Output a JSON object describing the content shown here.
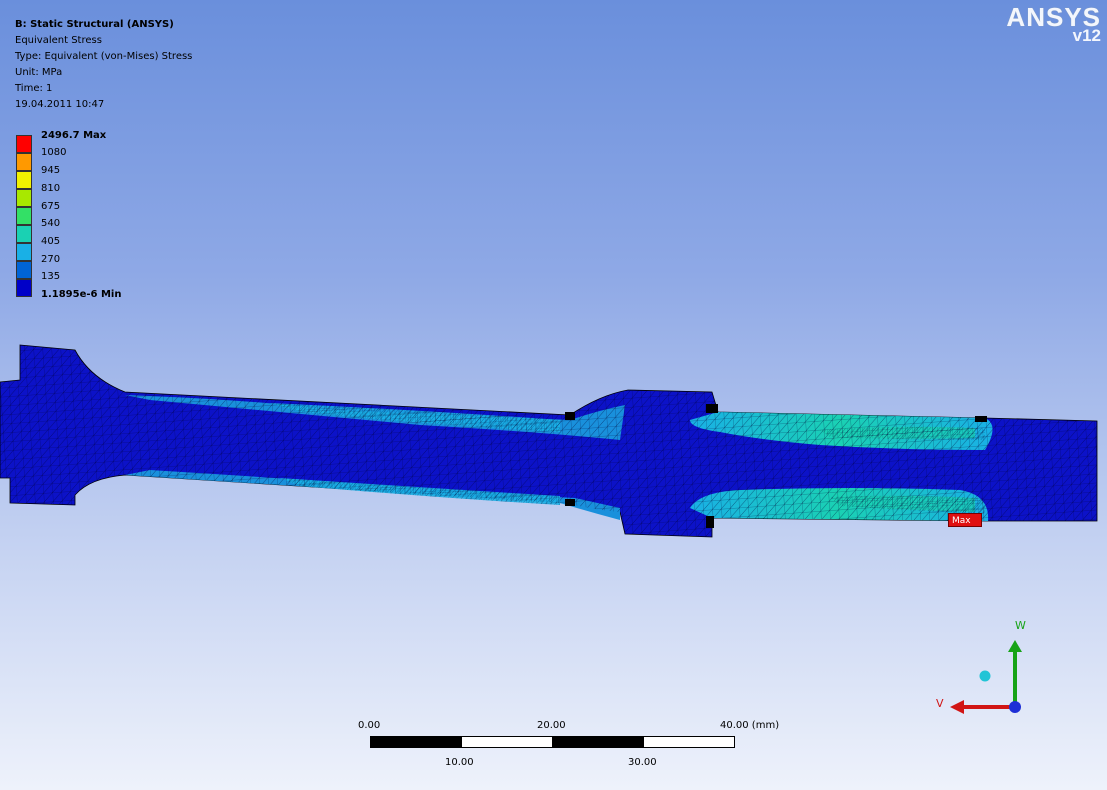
{
  "header": {
    "title": "B: Static Structural (ANSYS)",
    "result": "Equivalent Stress",
    "type": "Type: Equivalent (von-Mises) Stress",
    "unit": "Unit: MPa",
    "time": "Time: 1",
    "date": "19.04.2011 10:47"
  },
  "logo": {
    "name": "ANSYS",
    "version": "v12"
  },
  "legend": {
    "max_label": "2496.7 Max",
    "min_label": "1.1895e-6 Min",
    "levels": [
      "1080",
      "945",
      "810",
      "675",
      "540",
      "405",
      "270",
      "135"
    ],
    "colors": [
      "#ff0000",
      "#ff9900",
      "#f2f200",
      "#a8e800",
      "#33e066",
      "#1ad1b3",
      "#19b0e6",
      "#0064d6",
      "#0000c8"
    ]
  },
  "probe": {
    "max_tag": "Max"
  },
  "triad": {
    "axis_vertical": "W",
    "axis_horizontal": "V",
    "colors": {
      "w": "#17a317",
      "v": "#d11515",
      "u": "#1e2fd6",
      "iso": "#21c4d6"
    }
  },
  "scale_bar": {
    "top_labels": [
      "0.00",
      "20.00",
      "40.00 (mm)"
    ],
    "bottom_labels": [
      "10.00",
      "30.00"
    ]
  }
}
